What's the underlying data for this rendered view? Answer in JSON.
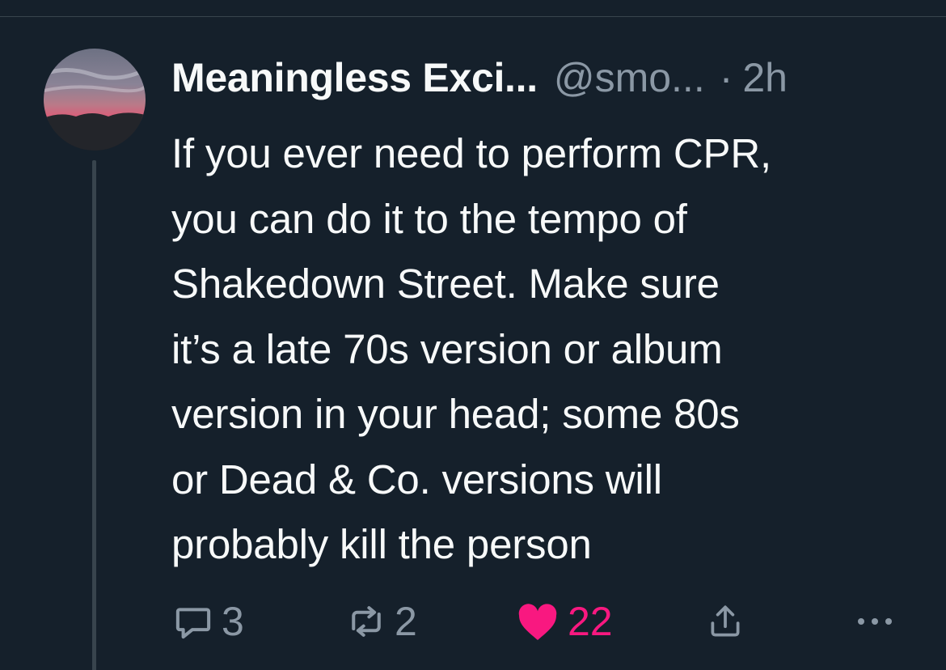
{
  "colors": {
    "background": "#15202b",
    "text_primary": "#f7f9f9",
    "text_secondary": "#8b98a5",
    "like_active": "#f91880",
    "divider": "#38444d"
  },
  "tweet": {
    "display_name": "Meaningless Exci...",
    "handle": "@smo...",
    "separator": "·",
    "time": "2h",
    "text_lines": [
      "If you ever need to perform CPR,",
      "you can do it to the tempo of",
      "Shakedown Street. Make sure",
      "it’s a late 70s version or album",
      "version in your head; some 80s",
      "or Dead & Co. versions will",
      "probably kill the person"
    ]
  },
  "actions": {
    "reply": {
      "icon": "reply-icon",
      "count": "3"
    },
    "retweet": {
      "icon": "retweet-icon",
      "count": "2"
    },
    "like": {
      "icon": "heart-icon",
      "count": "22",
      "liked": true
    },
    "share": {
      "icon": "share-icon"
    },
    "more": {
      "icon": "more-icon"
    }
  }
}
